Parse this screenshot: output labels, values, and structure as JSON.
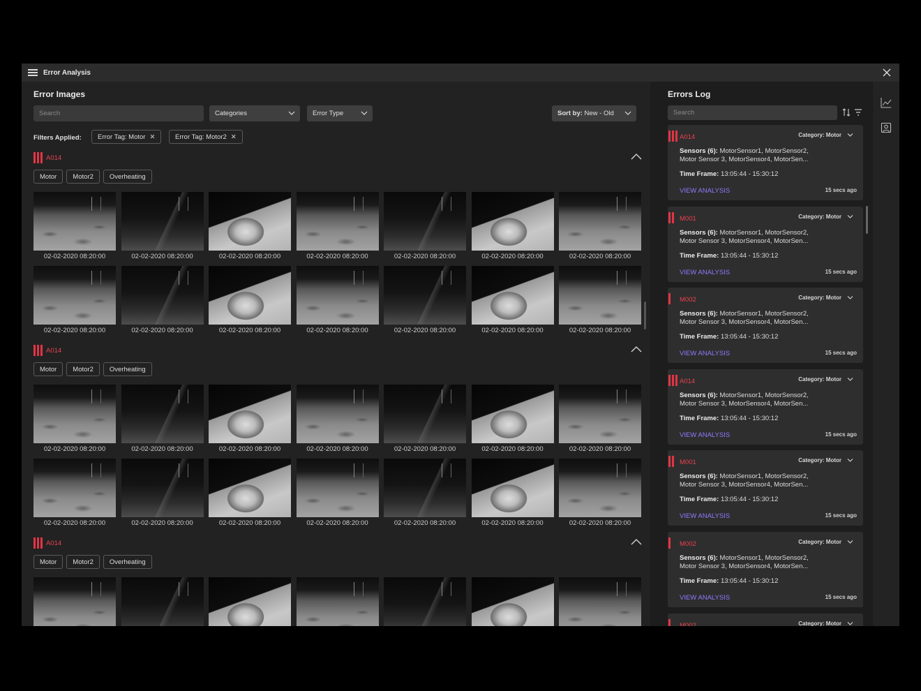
{
  "window": {
    "title": "Error Analysis"
  },
  "error_images": {
    "title": "Error Images",
    "search_placeholder": "Search",
    "categories_label": "Categories",
    "error_type_label": "Error Type",
    "sort_prefix": "Sort by:",
    "sort_value": "New - Old",
    "filters_label": "Filters Applied:",
    "filters": [
      "Error Tag: Motor",
      "Error Tag: Motor2"
    ],
    "groups": [
      {
        "id": "A014",
        "tags": [
          "Motor",
          "Motor2",
          "Overheating"
        ]
      },
      {
        "id": "A014",
        "tags": [
          "Motor",
          "Motor2",
          "Overheating"
        ]
      },
      {
        "id": "A014",
        "tags": [
          "Motor",
          "Motor2",
          "Overheating"
        ]
      }
    ],
    "thumb_pattern": [
      "floor",
      "dark",
      "rock",
      "floor",
      "dark",
      "rock",
      "floor"
    ],
    "timestamp": "02-02-2020 08:20:00"
  },
  "errors_log": {
    "title": "Errors Log",
    "search_placeholder": "Search",
    "sensors_label": "Sensors (6):",
    "timeframe_label": "Time Frame:",
    "view_analysis": "VIEW ANALYSIS",
    "entries": [
      {
        "id": "A014",
        "bars": 3,
        "category": "Category: Motor",
        "sensors": "MotorSensor1, MotorSensor2, Motor Sensor 3, MotorSensor4, MotorSen...",
        "time_frame": "13:05:44 - 15:30:12",
        "ago": "15 secs ago"
      },
      {
        "id": "M001",
        "bars": 2,
        "category": "Category: Motor",
        "sensors": "MotorSensor1, MotorSensor2, Motor Sensor 3, MotorSensor4, MotorSen...",
        "time_frame": "13:05:44 - 15:30:12",
        "ago": "15 secs ago"
      },
      {
        "id": "M002",
        "bars": 1,
        "category": "Category: Motor",
        "sensors": "MotorSensor1, MotorSensor2, Motor Sensor 3, MotorSensor4, MotorSen...",
        "time_frame": "13:05:44 - 15:30:12",
        "ago": "15 secs ago"
      },
      {
        "id": "A014",
        "bars": 3,
        "category": "Category: Motor",
        "sensors": "MotorSensor1, MotorSensor2, Motor Sensor 3, MotorSensor4, MotorSen...",
        "time_frame": "13:05:44 - 15:30:12",
        "ago": "15 secs ago"
      },
      {
        "id": "M001",
        "bars": 2,
        "category": "Category: Motor",
        "sensors": "MotorSensor1, MotorSensor2, Motor Sensor 3, MotorSensor4, MotorSen...",
        "time_frame": "13:05:44 - 15:30:12",
        "ago": "15 secs ago"
      },
      {
        "id": "M002",
        "bars": 1,
        "category": "Category: Motor",
        "sensors": "MotorSensor1, MotorSensor2, Motor Sensor 3, MotorSensor4, MotorSen...",
        "time_frame": "13:05:44 - 15:30:12",
        "ago": "15 secs ago"
      },
      {
        "id": "M002",
        "bars": 1,
        "category": "Category: Motor",
        "sensors": "",
        "time_frame": "",
        "ago": ""
      }
    ]
  },
  "icons": {
    "menu": "hamburger-icon",
    "close": "close-icon",
    "sort": "sort-icon",
    "filter": "filter-icon",
    "rail": [
      "line-chart-icon",
      "profile-card-icon"
    ]
  },
  "colors": {
    "accent_red": "#e03545",
    "link_purple": "#8f7bff",
    "background": "#222222"
  }
}
